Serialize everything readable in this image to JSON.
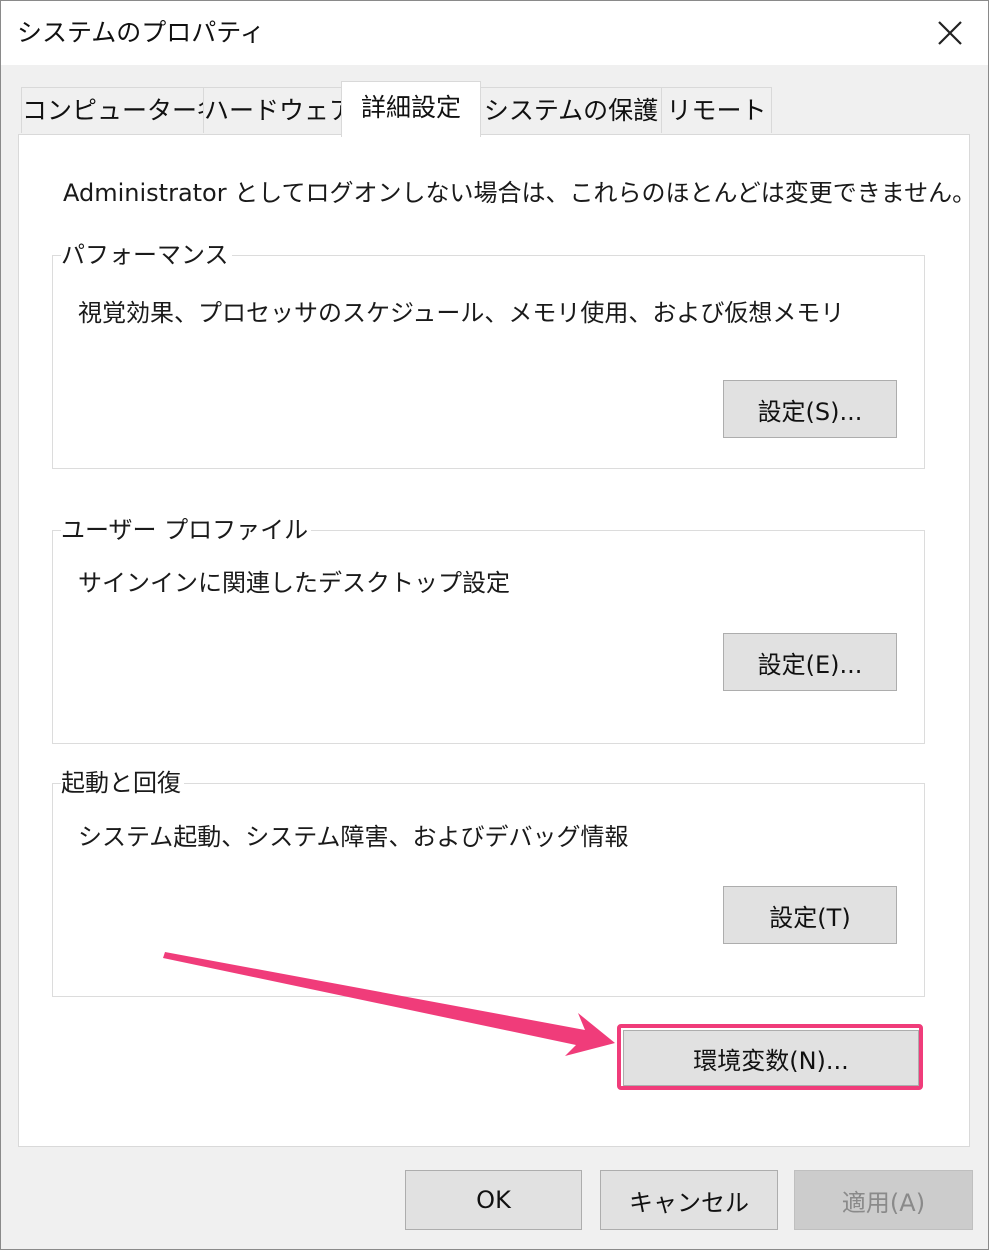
{
  "window": {
    "title": "システムのプロパティ",
    "close_icon": "close-icon"
  },
  "tabs": [
    {
      "label": "コンピューター名",
      "active": false
    },
    {
      "label": "ハードウェア",
      "active": false
    },
    {
      "label": "詳細設定",
      "active": true
    },
    {
      "label": "システムの保護",
      "active": false
    },
    {
      "label": "リモート",
      "active": false
    }
  ],
  "advanced": {
    "intro": "Administrator としてログオンしない場合は、これらのほとんどは変更できません。",
    "performance": {
      "title": "パフォーマンス",
      "description": "視覚効果、プロセッサのスケジュール、メモリ使用、および仮想メモリ",
      "button_label": "設定(S)..."
    },
    "user_profiles": {
      "title": "ユーザー プロファイル",
      "description": "サインインに関連したデスクトップ設定",
      "button_label": "設定(E)..."
    },
    "startup_recovery": {
      "title": "起動と回復",
      "description": "システム起動、システム障害、およびデバッグ情報",
      "button_label": "設定(T)"
    },
    "env_vars_button_label": "環境変数(N)..."
  },
  "footer": {
    "ok_label": "OK",
    "cancel_label": "キャンセル",
    "apply_label": "適用(A)"
  },
  "annotation": {
    "highlight_color": "#f03c7a"
  }
}
